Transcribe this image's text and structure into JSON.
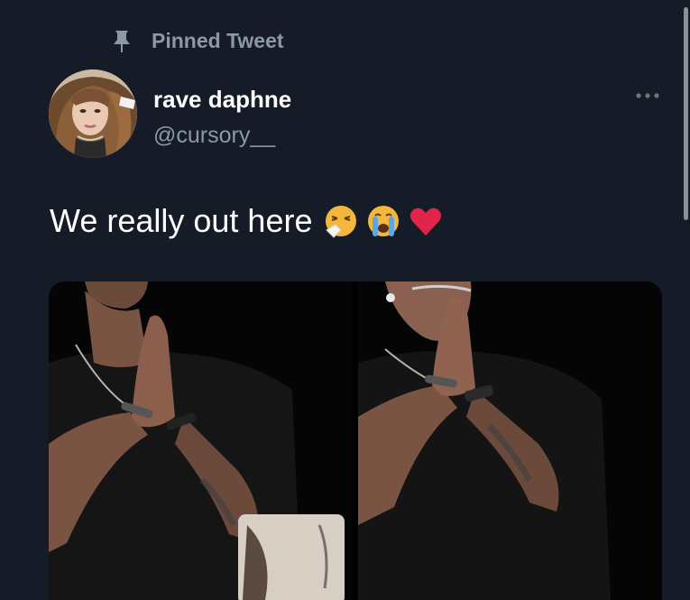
{
  "pinned": {
    "label": "Pinned Tweet",
    "icon": "pin-icon"
  },
  "author": {
    "name": "rave daphne",
    "handle": "@cursory__",
    "avatar_icon": "avatar"
  },
  "tweet": {
    "text": "We really out here",
    "emojis": [
      "sneezing-face-emoji",
      "loudly-crying-face-emoji",
      "red-heart-emoji"
    ]
  },
  "media": {
    "count": 2,
    "items": [
      "photo-left",
      "photo-right"
    ]
  },
  "colors": {
    "background": "#161c27",
    "text_primary": "#ffffff",
    "text_secondary": "#8b98a5",
    "heart": "#e0245e"
  }
}
